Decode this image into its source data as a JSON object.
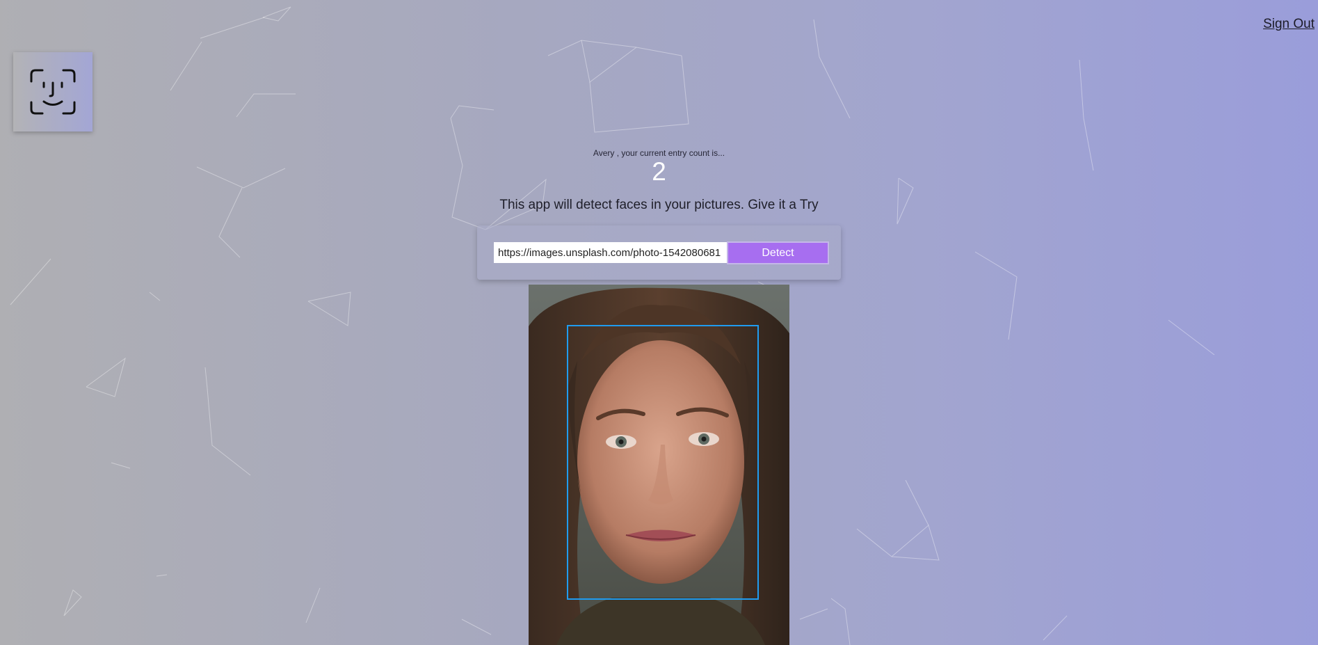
{
  "header": {
    "signout_label": "Sign Out"
  },
  "logo": {
    "icon": "face-id-icon"
  },
  "rank": {
    "message": "Avery , your current entry count is...",
    "count": "2"
  },
  "tagline": "This app will detect faces in your pictures. Give it a Try",
  "form": {
    "url_value": "https://images.unsplash.com/photo-1542080681",
    "detect_label": "Detect"
  },
  "result": {
    "box_color": "#1f9cf0"
  },
  "colors": {
    "accent": "#a76ef0",
    "gradient_start": "#afafb3",
    "gradient_end": "#9a9dda"
  }
}
